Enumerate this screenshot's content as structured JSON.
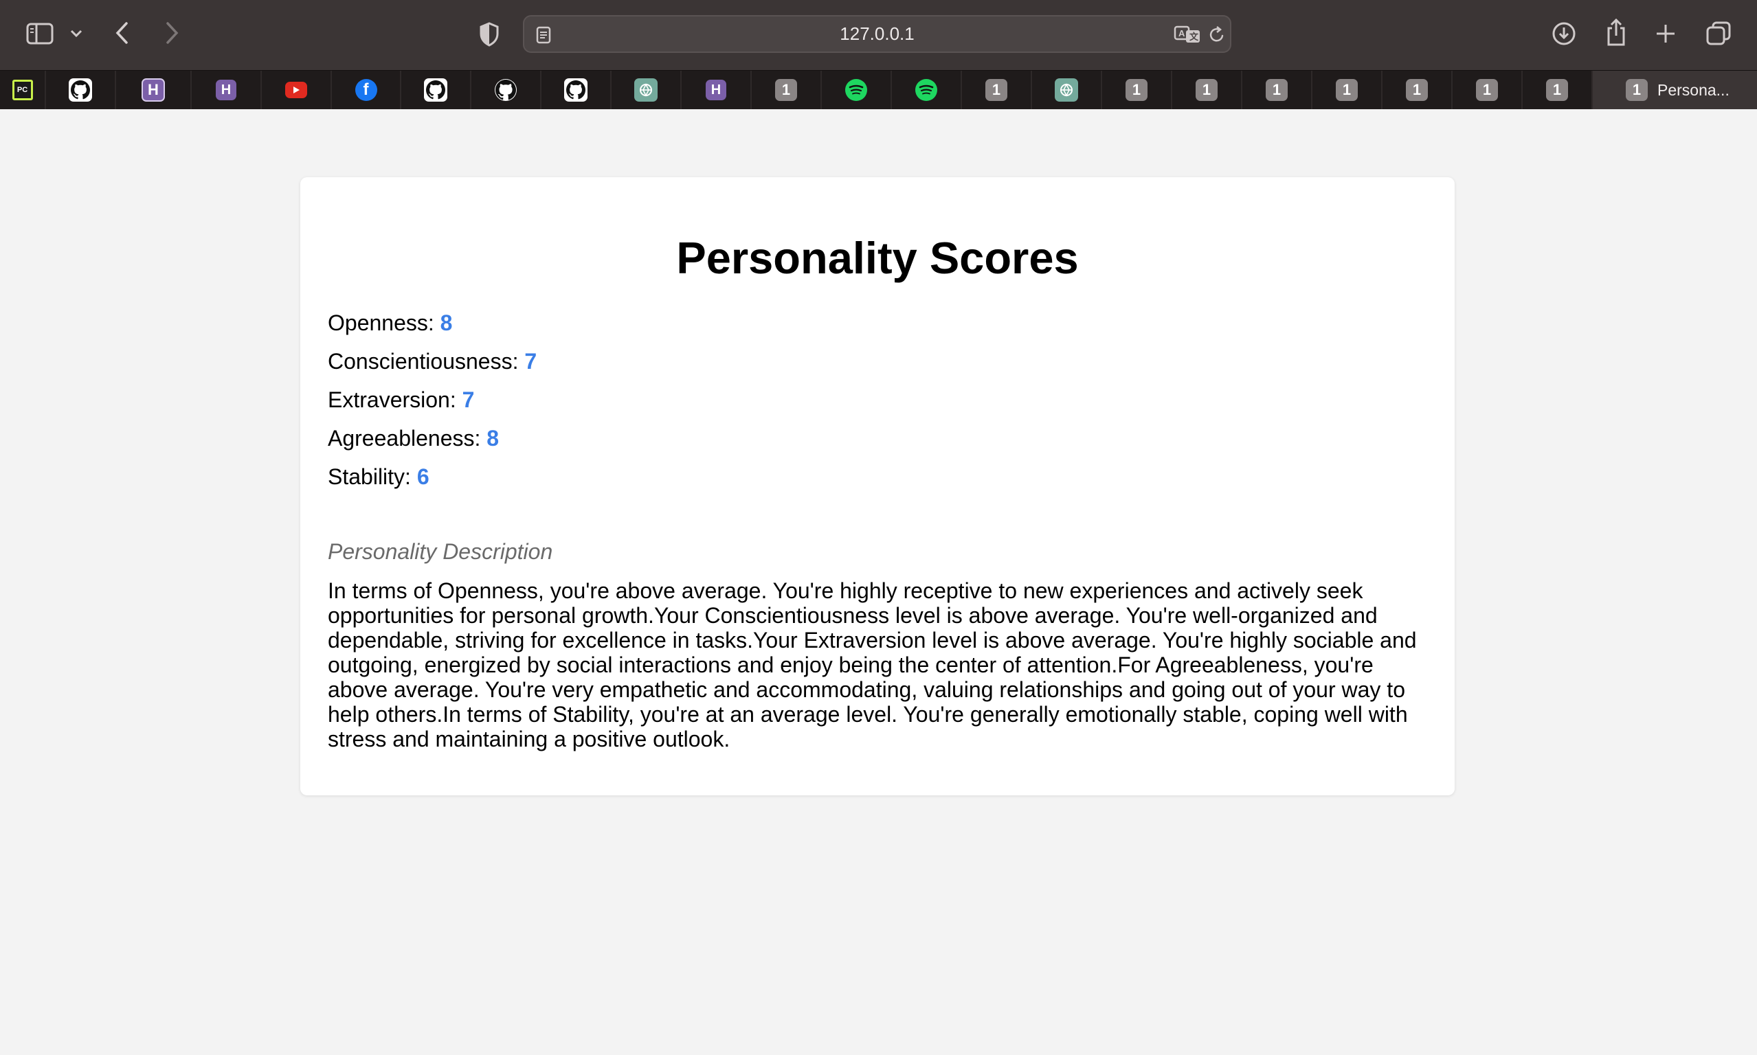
{
  "browser": {
    "url": "127.0.0.1",
    "tabs": [
      {
        "icon": "pycharm-icon"
      },
      {
        "icon": "github-icon"
      },
      {
        "icon": "heroku-icon"
      },
      {
        "icon": "heroku-icon"
      },
      {
        "icon": "youtube-icon"
      },
      {
        "icon": "facebook-icon"
      },
      {
        "icon": "github-icon"
      },
      {
        "icon": "github-icon"
      },
      {
        "icon": "github-icon"
      },
      {
        "icon": "chatgpt-icon"
      },
      {
        "icon": "heroku-icon"
      },
      {
        "icon": "number-icon",
        "badge": "1"
      },
      {
        "icon": "spotify-icon"
      },
      {
        "icon": "spotify-icon"
      },
      {
        "icon": "number-icon",
        "badge": "1"
      },
      {
        "icon": "chatgpt-icon"
      },
      {
        "icon": "number-icon",
        "badge": "1"
      },
      {
        "icon": "number-icon",
        "badge": "1"
      },
      {
        "icon": "number-icon",
        "badge": "1"
      },
      {
        "icon": "number-icon",
        "badge": "1"
      },
      {
        "icon": "number-icon",
        "badge": "1"
      },
      {
        "icon": "number-icon",
        "badge": "1"
      },
      {
        "icon": "number-icon",
        "badge": "1"
      }
    ],
    "active_tab": {
      "badge": "1",
      "title": "Persona..."
    }
  },
  "page": {
    "title": "Personality Scores",
    "scores": [
      {
        "label": "Openness:",
        "value": "8"
      },
      {
        "label": "Conscientiousness:",
        "value": "7"
      },
      {
        "label": "Extraversion:",
        "value": "7"
      },
      {
        "label": "Agreeableness:",
        "value": "8"
      },
      {
        "label": "Stability:",
        "value": "6"
      }
    ],
    "description_title": "Personality Description",
    "description": "In terms of Openness, you're above average. You're highly receptive to new experiences and actively seek opportunities for personal growth.Your Conscientiousness level is above average. You're well-organized and dependable, striving for excellence in tasks.Your Extraversion level is above average. You're highly sociable and outgoing, energized by social interactions and enjoy being the center of attention.For Agreeableness, you're above average. You're very empathetic and accommodating, valuing relationships and going out of your way to help others.In terms of Stability, you're at an average level. You're generally emotionally stable, coping well with stress and maintaining a positive outlook."
  },
  "colors": {
    "score_value": "#3a7ee6",
    "toolbar_bg": "#3b3535",
    "tabbar_bg": "#1f1b1b",
    "page_bg": "#f3f3f3"
  }
}
